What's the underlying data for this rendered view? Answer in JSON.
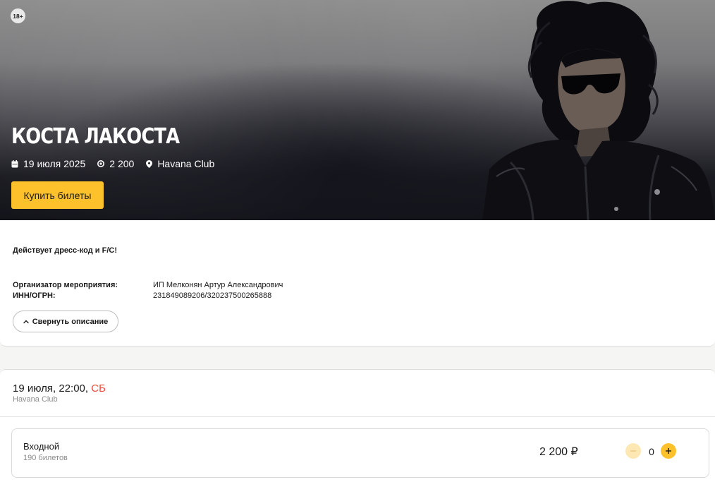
{
  "hero": {
    "age_rating": "18+",
    "title": "КОСТА ЛАКОСТА",
    "date": "19 июля 2025",
    "price": "2 200",
    "venue": "Havana Club",
    "buy_label": "Купить билеты",
    "accent_color": "#fcc12b"
  },
  "description": {
    "dress_code": "Действует дресс-код и F/C!",
    "organizer_label": "Организатор мероприятия:",
    "organizer_value": "ИП Мелконян Артур Александрович",
    "inn_label": "ИНН/ОГРН:",
    "inn_value": "231849089206/320237500265888",
    "collapse_label": "Свернуть описание"
  },
  "session": {
    "date_time": "19 июля, 22:00,",
    "weekday": "СБ",
    "weekday_color": "#e84b3c",
    "venue": "Havana Club",
    "tickets": [
      {
        "name": "Входной",
        "available": "190 билетов",
        "price": "2 200 ₽",
        "quantity": "0"
      }
    ]
  },
  "icons": {
    "date": "calendar-icon",
    "price": "coin-icon",
    "venue": "location-pin-icon",
    "collapse": "chevron-up-icon",
    "decrease": "minus-icon",
    "increase": "plus-icon"
  }
}
